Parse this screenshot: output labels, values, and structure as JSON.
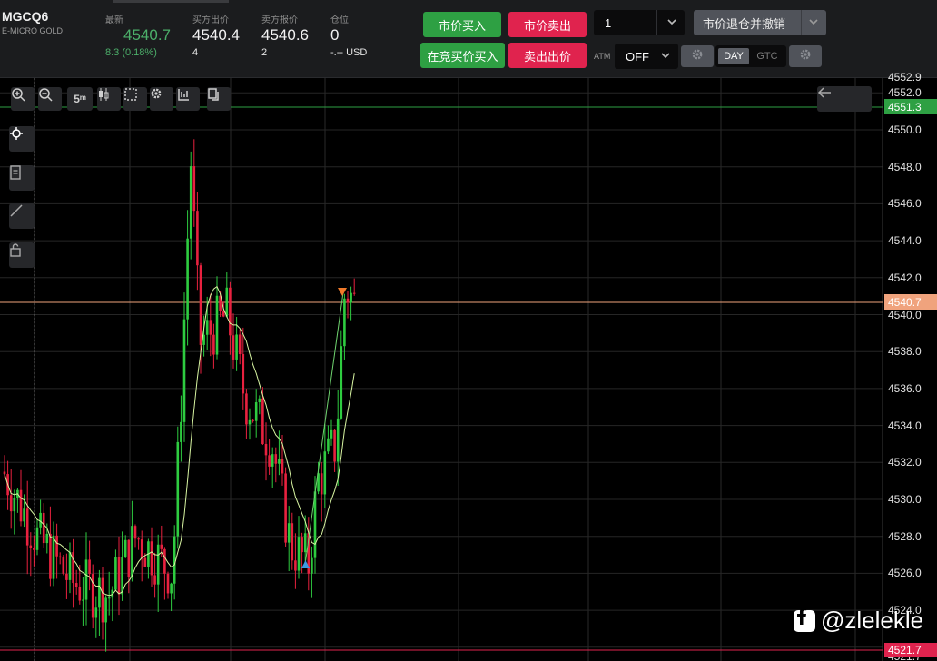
{
  "header": {
    "symbol": "MGCQ6",
    "symbol_desc": "E-MICRO GOLD",
    "last_label": "最新",
    "last_value": "4540.7",
    "change": "8.3 (0.18%)",
    "bid_label": "买方出价",
    "bid_value": "4540.4",
    "bid_size": "4",
    "ask_label": "卖方报价",
    "ask_value": "4540.6",
    "ask_size": "2",
    "position_label": "仓位",
    "position_value": "0",
    "position_pnl": "-.-- USD"
  },
  "order": {
    "buy_market": "市价买入",
    "sell_market": "市价卖出",
    "buy_bid": "在竞买价买入",
    "sell_ask": "卖出出价",
    "quantity": "1",
    "flatten": "市价退仓并撤销",
    "atm_label": "ATM",
    "atm_value": "OFF",
    "tif_day": "DAY",
    "tif_gtc": "GTC"
  },
  "toolbar": {
    "timeframe": "5ᵐ"
  },
  "axis": {
    "ticks": [
      "4552.9",
      "4552.0",
      "4550.0",
      "4548.0",
      "4546.0",
      "4544.0",
      "4542.0",
      "4540.0",
      "4538.0",
      "4536.0",
      "4534.0",
      "4532.0",
      "4530.0",
      "4528.0",
      "4526.0",
      "4524.0",
      "4521.7"
    ],
    "tag_green": "4551.3",
    "tag_last": "4540.7",
    "tag_red": "4521.7"
  },
  "watermark": "@zlelekle",
  "colors": {
    "up": "#2ecc40",
    "down": "#e8213f",
    "ma": "#d8f5a2",
    "last_line": "#f0a37d",
    "green_line": "#2ea043",
    "red_line": "#e0234e"
  }
}
